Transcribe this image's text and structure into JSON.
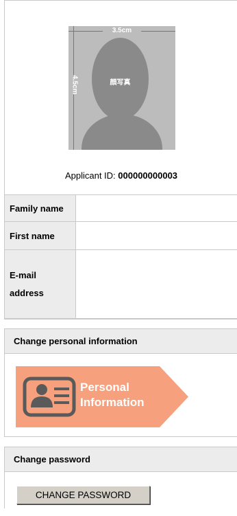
{
  "photo": {
    "width_label": "3.5cm",
    "height_label": "4.5cm",
    "face_label": "顔写真"
  },
  "applicant": {
    "label": "Applicant ID:",
    "id": "000000000003"
  },
  "fields": [
    {
      "label": "Family name",
      "value": ""
    },
    {
      "label": "First name",
      "value": ""
    },
    {
      "label": "E-mail address",
      "label_line1": "E-mail",
      "label_line2": "address",
      "value": ""
    }
  ],
  "personal_section": {
    "header": "Change personal information",
    "badge_line1": "Personal",
    "badge_line2": "Information",
    "badge_color": "#f6a07d",
    "icon_color": "#5a5a5a"
  },
  "password_section": {
    "header": "Change password",
    "button_label": "CHANGE PASSWORD"
  }
}
